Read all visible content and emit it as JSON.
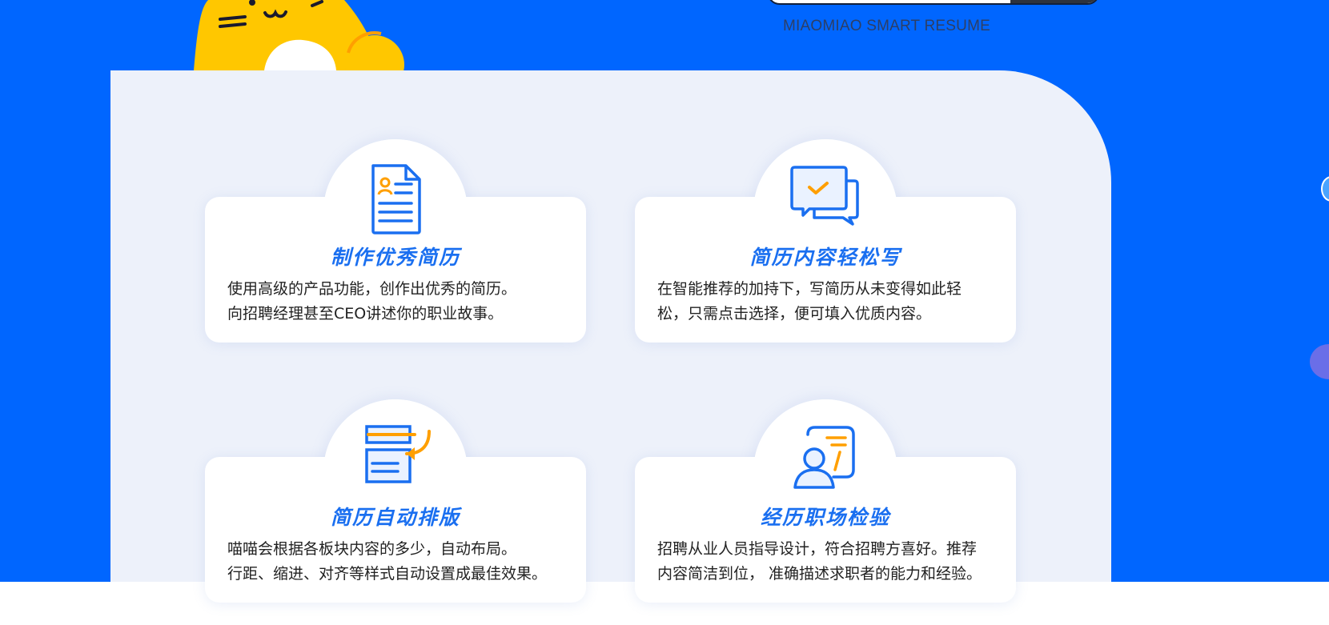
{
  "brand": {
    "tagline": "MIAOMIAO SMART RESUME"
  },
  "search": {
    "button_icon": "search-button"
  },
  "colors": {
    "hero_blue": "#0066ff",
    "panel_bg": "#edf1fa",
    "title_blue": "#1a6ff0",
    "icon_orange": "#ff9f00",
    "mascot_yellow": "#ffc700"
  },
  "features": [
    {
      "icon": "resume-document-icon",
      "title": "制作优秀简历",
      "description": "使用高级的产品功能，创作出优秀的简历。\n向招聘经理甚至CEO讲述你的职业故事。"
    },
    {
      "icon": "chat-check-icon",
      "title": "简历内容轻松写",
      "description": "在智能推荐的加持下，写简历从未变得如此轻\n松，只需点击选择，便可填入优质内容。"
    },
    {
      "icon": "auto-layout-icon",
      "title": "简历自动排版",
      "description": "喵喵会根据各板块内容的多少，自动布局。\n行距、缩进、对齐等样式自动设置成最佳效果。"
    },
    {
      "icon": "career-person-icon",
      "title": "经历职场检验",
      "description": "招聘从业人员指导设计，符合招聘方喜好。推荐\n内容简洁到位， 准确描述求职者的能力和经验。"
    }
  ]
}
